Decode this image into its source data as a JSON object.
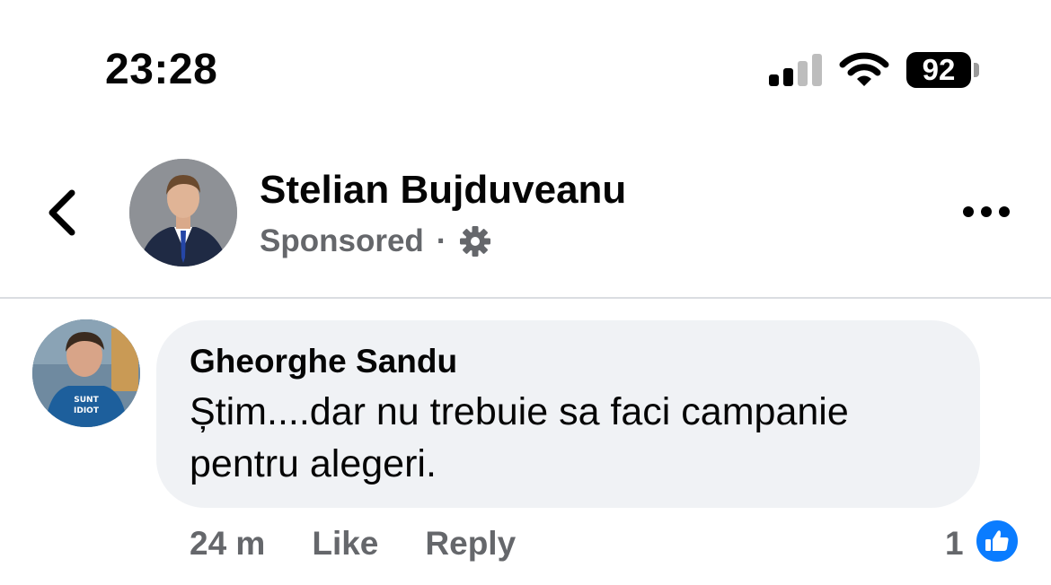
{
  "status_bar": {
    "time": "23:28",
    "battery": "92",
    "icons": [
      "signal-icon",
      "wifi-icon",
      "battery-icon"
    ]
  },
  "header": {
    "page_name": "Stelian Bujduveanu",
    "sponsored": "Sponsored",
    "separator": "·",
    "icons": [
      "back-icon",
      "gear-icon",
      "more-icon"
    ]
  },
  "comment": {
    "author": "Gheorghe Sandu",
    "text": "Știm....dar nu trebuie sa faci campanie pentru alegeri.",
    "avatar_shirt_text": "SUNT IDIOT",
    "time": "24 m",
    "like_label": "Like",
    "reply_label": "Reply",
    "reaction_count": "1",
    "reaction_icon": "thumbs-up-icon"
  },
  "colors": {
    "secondary_text": "#65676b",
    "bubble": "#f0f2f5",
    "like_blue": "#0a7cff"
  }
}
